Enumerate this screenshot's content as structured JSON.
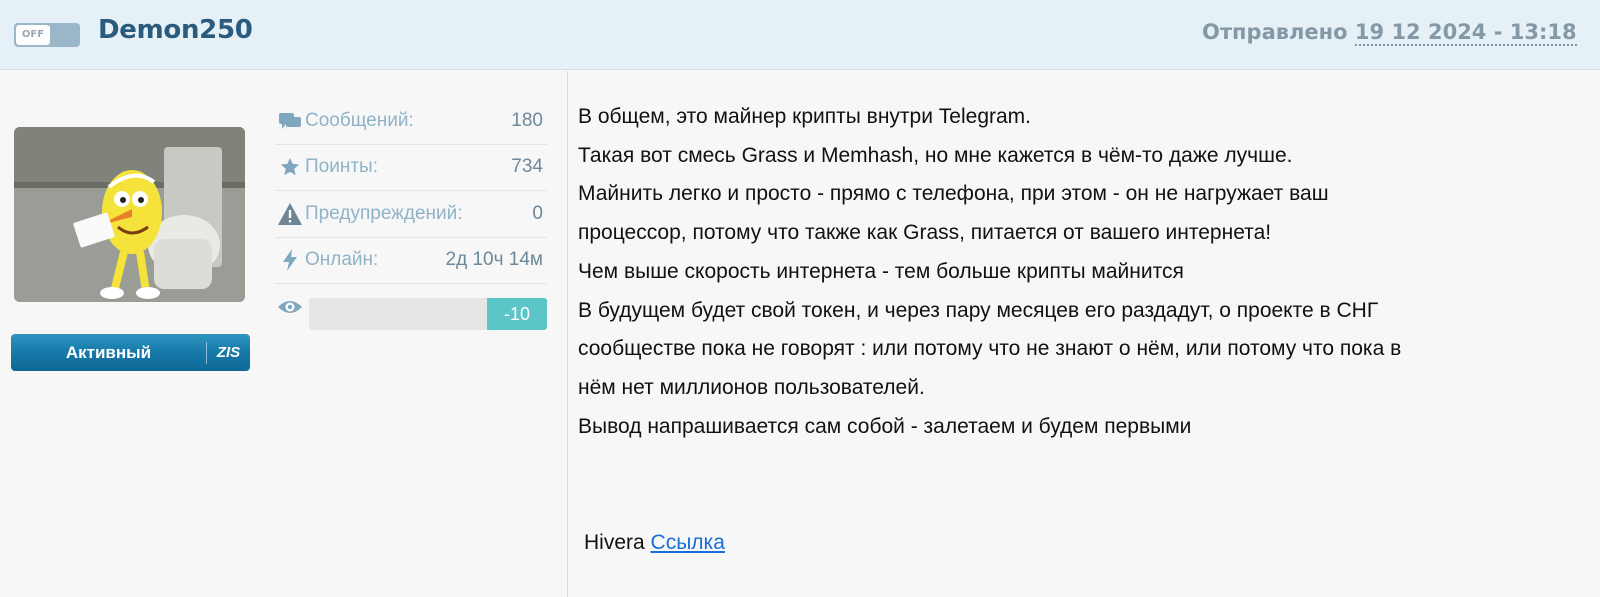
{
  "header": {
    "toggle_label": "OFF",
    "username": "Demon250",
    "sent_label": "Отправлено",
    "sent_date": "19 12 2024 - 13:18"
  },
  "user": {
    "rank_label": "Активный",
    "rank_logo": "ZIS",
    "stats": [
      {
        "icon": "messages-icon",
        "label": "Сообщений:",
        "value": "180"
      },
      {
        "icon": "star-icon",
        "label": "Поинты:",
        "value": "734"
      },
      {
        "icon": "warning-icon",
        "label": "Предупреждений:",
        "value": "0"
      },
      {
        "icon": "lightning-icon",
        "label": "Онлайн:",
        "value": "2д 10ч 14м"
      }
    ],
    "reputation": {
      "icon": "eye-icon",
      "value": "-10"
    }
  },
  "post": {
    "lines": [
      "В общем, это майнер крипты внутри Telegram.",
      "Такая вот смесь Grass и Memhash, но мне кажется в чём-то даже лучше.",
      "Майнить легко и просто - прямо с телефона, при этом - он не нагружает ваш",
      "процессор, потому что также как Grass, питается от вашего интернета!",
      "Чем выше скорость интернета  - тем больше крипты майнится",
      "В будущем будет свой токен, и через пару месяцев его раздадут, о проекте в СНГ",
      "сообществе пока не говорят : или потому что не знают о нём, или потому что пока в",
      "нём нет миллионов пользователей.",
      "Вывод напрашивается сам собой - залетаем и будем первыми"
    ],
    "signature_text": "Hivera",
    "signature_link": "Ссылка "
  },
  "colors": {
    "header_bg": "#e6f0f7",
    "username": "#2a5b7e",
    "stat_label": "#8fb3c7",
    "reputation_fill": "#5bc5c8",
    "rank_badge": "#1779a8",
    "link": "#1a6ed8"
  }
}
